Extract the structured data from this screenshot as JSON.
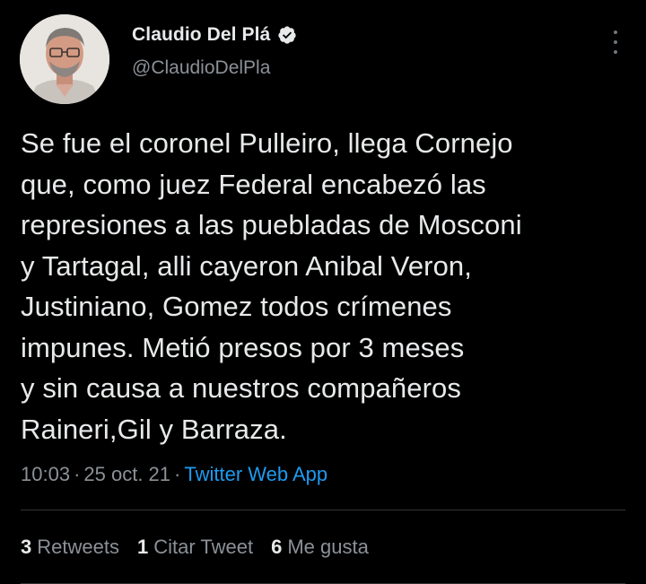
{
  "author": {
    "display_name": "Claudio Del Plá",
    "handle": "@ClaudioDelPla",
    "verified": true,
    "avatar": "avatar-photo"
  },
  "tweet": {
    "text": "Se fue el coronel Pulleiro, llega Cornejo\nque, como juez Federal encabezó las\nrepresiones a las puebladas de Mosconi\ny Tartagal, alli cayeron Anibal Veron,\nJustiniano, Gomez todos crímenes\nimpunes. Metió presos por 3 meses\ny sin causa a nuestros compañeros\nRaineri,Gil y Barraza.",
    "time": "10:03",
    "date": "25 oct. 21",
    "source": "Twitter Web App",
    "separator": "·"
  },
  "stats": {
    "retweets_count": "3",
    "retweets_label": "Retweets",
    "quotes_count": "1",
    "quotes_label": "Citar Tweet",
    "likes_count": "6",
    "likes_label": "Me gusta"
  },
  "colors": {
    "background": "#000000",
    "text": "#e7e9ea",
    "secondary": "#8b9197",
    "link": "#1d9bf0",
    "verified_badge": "#e7e9ea"
  },
  "icons": [
    "verified-badge-icon",
    "more-options-icon"
  ]
}
